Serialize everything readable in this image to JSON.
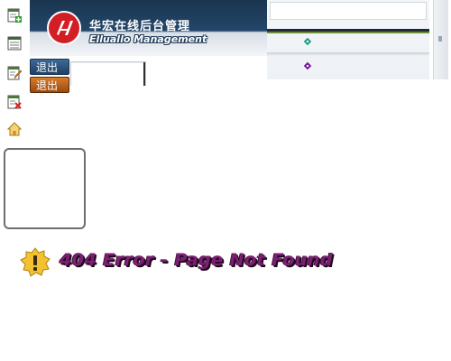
{
  "header": {
    "title_cn": "华宏在线后台管理",
    "title_en": "Elluallo Management"
  },
  "sidebar": {
    "icons": [
      "add-document-icon",
      "list-window-icon",
      "edit-document-icon",
      "delete-document-icon",
      "home-icon"
    ]
  },
  "buttons": {
    "exit_primary": "退出",
    "exit_secondary": "退出"
  },
  "error": {
    "message": "404 Error - Page Not Found",
    "icon": "warning-badge-icon"
  },
  "colors": {
    "banner_dark": "#1a3550",
    "error_text": "#7d1f73",
    "diamond_teal": "#1aa08a",
    "diamond_purple": "#7a1a9a"
  }
}
